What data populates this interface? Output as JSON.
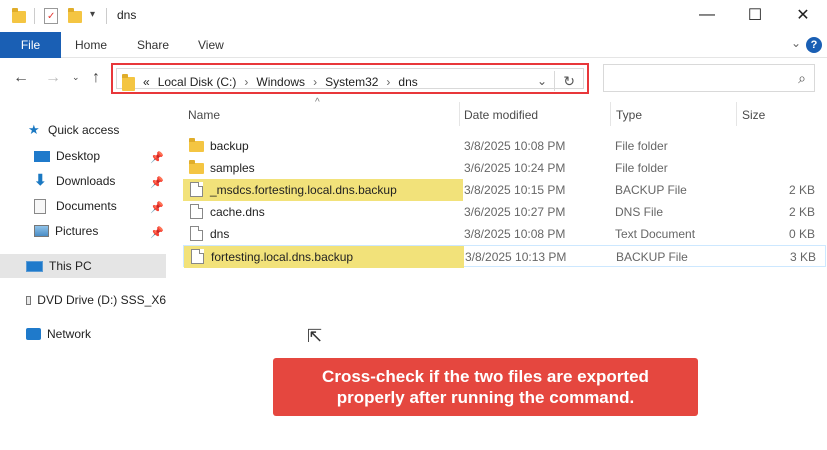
{
  "window": {
    "title": "dns",
    "controls": {
      "minimize": "—",
      "maximize": "☐",
      "close": "✕"
    }
  },
  "ribbon": {
    "tabs": [
      "File",
      "Home",
      "Share",
      "View"
    ],
    "help": "?"
  },
  "address": {
    "overflow": "«",
    "crumbs": [
      "Local Disk (C:)",
      "Windows",
      "System32",
      "dns"
    ],
    "separator": "›"
  },
  "search": {
    "placeholder": ""
  },
  "sidebar": {
    "items": [
      {
        "label": "Quick access",
        "icon": "star-icon"
      },
      {
        "label": "Desktop",
        "icon": "desktop-icon",
        "pinned": true
      },
      {
        "label": "Downloads",
        "icon": "download-icon",
        "pinned": true
      },
      {
        "label": "Documents",
        "icon": "documents-icon",
        "pinned": true
      },
      {
        "label": "Pictures",
        "icon": "pictures-icon",
        "pinned": true
      },
      {
        "label": "This PC",
        "icon": "pc-icon",
        "selected": true
      },
      {
        "label": "DVD Drive (D:) SSS_X6",
        "icon": "dvd-icon"
      },
      {
        "label": "Network",
        "icon": "network-icon"
      }
    ]
  },
  "columns": {
    "name": "Name",
    "date": "Date modified",
    "type": "Type",
    "size": "Size"
  },
  "files": [
    {
      "name": "backup",
      "date": "3/8/2025 10:08 PM",
      "type": "File folder",
      "size": "",
      "kind": "folder"
    },
    {
      "name": "samples",
      "date": "3/6/2025 10:24 PM",
      "type": "File folder",
      "size": "",
      "kind": "folder"
    },
    {
      "name": "_msdcs.fortesting.local.dns.backup",
      "date": "3/8/2025 10:15 PM",
      "type": "BACKUP File",
      "size": "2 KB",
      "kind": "doc",
      "highlight": true
    },
    {
      "name": "cache.dns",
      "date": "3/6/2025 10:27 PM",
      "type": "DNS File",
      "size": "2 KB",
      "kind": "doc"
    },
    {
      "name": "dns",
      "date": "3/8/2025 10:08 PM",
      "type": "Text Document",
      "size": "0 KB",
      "kind": "doc"
    },
    {
      "name": "fortesting.local.dns.backup",
      "date": "3/8/2025 10:13 PM",
      "type": "BACKUP File",
      "size": "3 KB",
      "kind": "doc",
      "highlight": true,
      "selected": true
    }
  ],
  "callout": {
    "line1": "Cross-check if the two files are exported",
    "line2": "properly after running the command."
  },
  "colors": {
    "accent": "#1a5fb4",
    "highlight": "#f2e27a",
    "callout": "#e5473f",
    "address_outline": "#e8373a"
  }
}
